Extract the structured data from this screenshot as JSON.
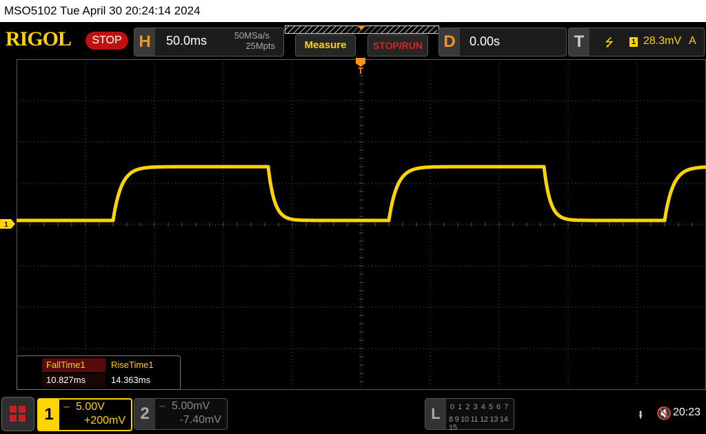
{
  "titlebar": {
    "text": "MSO5102  Tue April 30 20:24:14 2024"
  },
  "header": {
    "logo": "RIGOL",
    "run_state": "STOP",
    "horizontal": {
      "letter": "H",
      "scale": "50.0ms",
      "sample_rate": "50MSa/s",
      "memory_depth": "25Mpts"
    },
    "buttons": {
      "measure": "Measure",
      "stop_run": "STOP/RUN"
    },
    "delay": {
      "letter": "D",
      "value": "0.00s"
    },
    "trigger": {
      "letter": "T",
      "edge_icon": "rising-edge-icon",
      "edge_glyph": "⭍",
      "channel": "1",
      "level": "28.3mV",
      "mode": "A"
    }
  },
  "display": {
    "trigger_position_label": "T",
    "ch1_marker_label": "1",
    "colors": {
      "ch1": "#ffd400",
      "grid": "#5a5a5a",
      "background": "#000000"
    }
  },
  "measurements": {
    "items": [
      {
        "label": "FallTime1",
        "value": "10.827ms"
      },
      {
        "label": "RiseTime1",
        "value": "14.363ms"
      }
    ]
  },
  "channels": {
    "ch1": {
      "number": "1",
      "coupling_glyph": "⎓",
      "scale": "5.00V",
      "offset": "+200mV"
    },
    "ch2": {
      "number": "2",
      "coupling_glyph": "⎓",
      "scale": "5.00mV",
      "offset": "-7.40mV"
    }
  },
  "logic_analyzer": {
    "letter": "L",
    "row1": "0 1 2 3  4 5 6 7",
    "row2": "8 9 10 11 12 13 14 15"
  },
  "status": {
    "usb_glyph": "⭻",
    "mute_glyph": "🔇",
    "clock": "20:23"
  },
  "waveform": {
    "channel": "1",
    "low_level_div": 0.0,
    "high_level_div": 1.3,
    "period_div": 4.0,
    "first_rise_div": 1.4
  }
}
